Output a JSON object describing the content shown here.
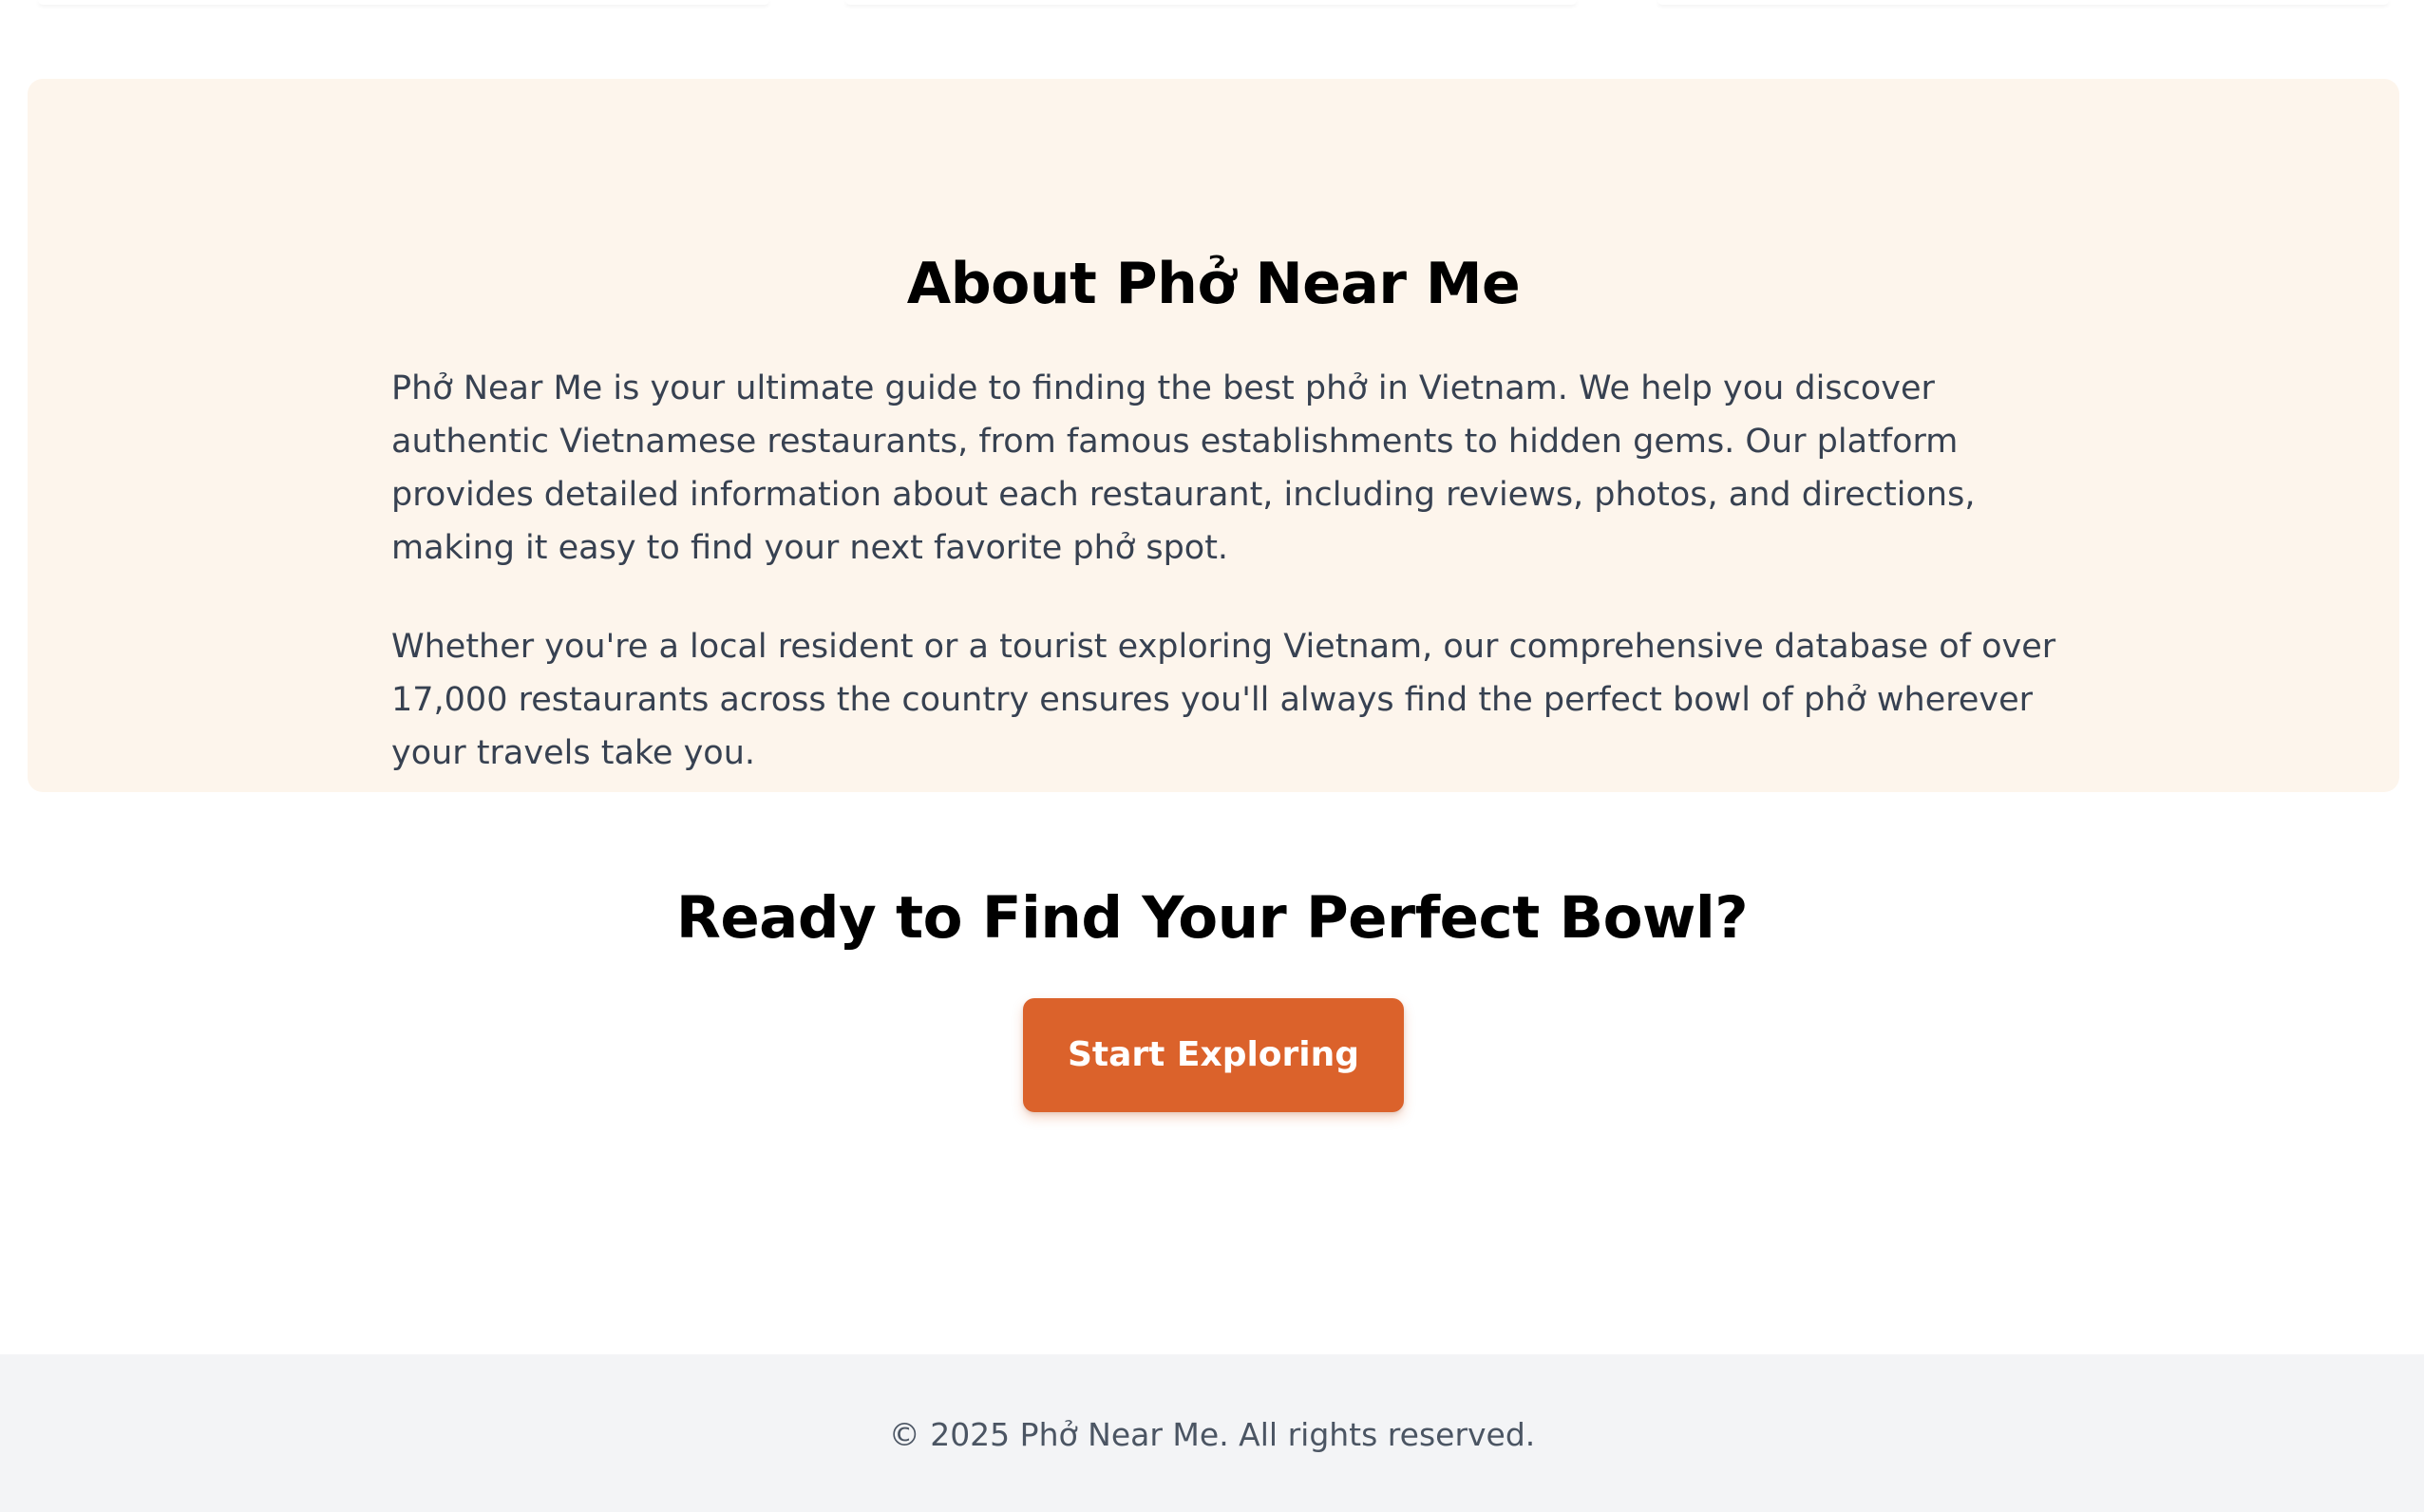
{
  "about": {
    "title": "About Phở Near Me",
    "paragraph_1": "Phở Near Me is your ultimate guide to finding the best phở in Vietnam. We help you discover authentic Vietnamese restaurants, from famous establishments to hidden gems. Our platform provides detailed information about each restaurant, including reviews, photos, and directions, making it easy to find your next favorite phở spot.",
    "paragraph_2": "Whether you're a local resident or a tourist exploring Vietnam, our comprehensive database of over 17,000 restaurants across the country ensures you'll always find the perfect bowl of phở wherever your travels take you."
  },
  "cta": {
    "title": "Ready to Find Your Perfect Bowl?",
    "button_label": "Start Exploring"
  },
  "footer": {
    "copyright": "© 2025 Phở Near Me. All rights reserved."
  },
  "colors": {
    "about_background": "#fdf5ec",
    "accent": "#db622b",
    "body_text": "#374151",
    "footer_background": "#f3f4f6",
    "footer_text": "#4b5563"
  }
}
